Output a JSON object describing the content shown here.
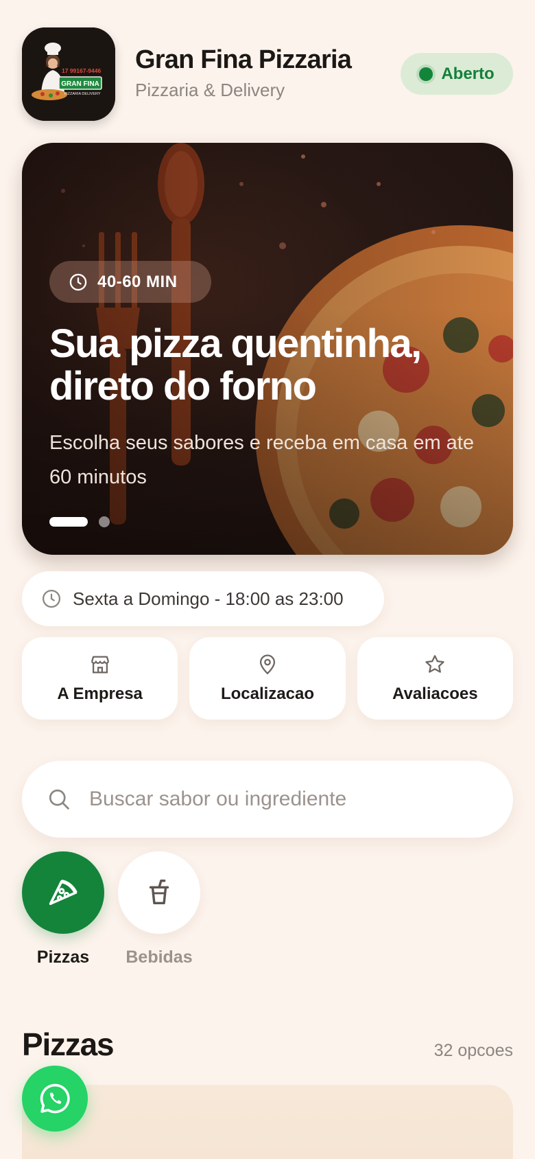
{
  "header": {
    "logo": {
      "phone": "17 99167-9446",
      "name": "GRAN FINA",
      "tagline": "PIZZARIA DELIVERY"
    },
    "title": "Gran Fina Pizzaria",
    "subtitle": "Pizzaria & Delivery",
    "status": "Aberto",
    "status_color": "#13853a"
  },
  "hero": {
    "time_chip": "40-60 MIN",
    "title": "Sua pizza quentinha, direto do forno",
    "subtitle": "Escolha seus sabores e receba em casa em ate 60 minutos",
    "slides": 2,
    "active_slide": 1
  },
  "hours": {
    "text": "Sexta a Domingo - 18:00 as 23:00",
    "icon": "clock-icon"
  },
  "info_cards": [
    {
      "label": "A Empresa",
      "icon": "store-icon"
    },
    {
      "label": "Localizacao",
      "icon": "map-pin-icon"
    },
    {
      "label": "Avaliacoes",
      "icon": "star-icon"
    }
  ],
  "search": {
    "placeholder": "Buscar sabor ou ingrediente",
    "value": ""
  },
  "categories": [
    {
      "label": "Pizzas",
      "icon": "pizza-slice-icon",
      "active": true
    },
    {
      "label": "Bebidas",
      "icon": "drink-cup-icon",
      "active": false
    }
  ],
  "section": {
    "title": "Pizzas",
    "count": "32 opcoes"
  },
  "colors": {
    "brand_green": "#14843b",
    "whatsapp_green": "#25d366",
    "background": "#fcf3ec"
  }
}
